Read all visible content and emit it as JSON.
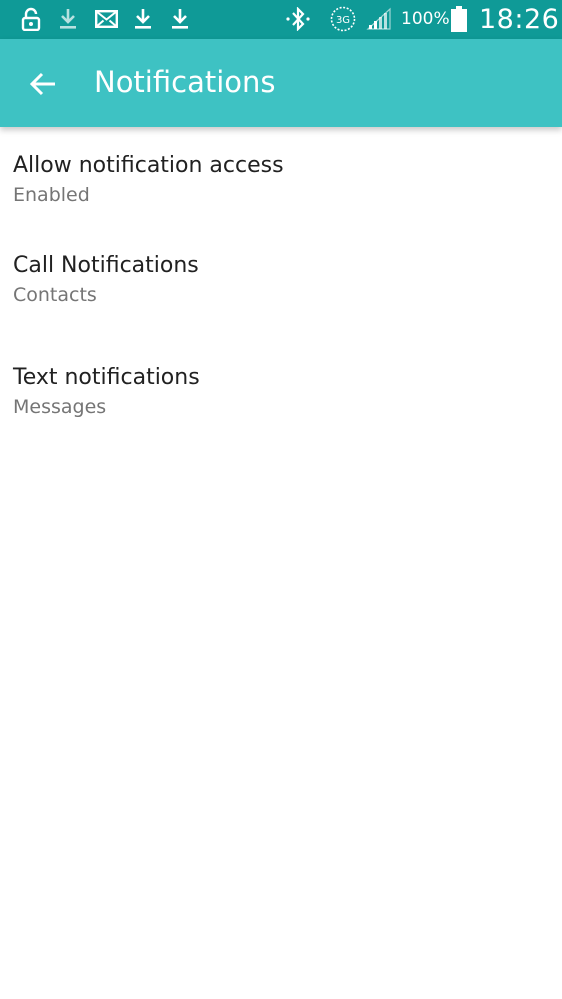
{
  "status_bar": {
    "icons": [
      "lock-icon",
      "download-icon",
      "mail-icon",
      "download-icon",
      "download-icon",
      "bluetooth-icon",
      "3g-icon",
      "signal-icon",
      "battery-icon"
    ],
    "badge_3g": "3G",
    "battery_percent": "100%",
    "time": "18:26"
  },
  "app_bar": {
    "title": "Notifications",
    "back_icon": "arrow-back-icon",
    "color": "#3ec2c3"
  },
  "settings": [
    {
      "title": "Allow notification access",
      "subtitle": "Enabled"
    },
    {
      "title": "Call Notifications",
      "subtitle": "Contacts"
    },
    {
      "title": "Text notifications",
      "subtitle": "Messages"
    }
  ]
}
